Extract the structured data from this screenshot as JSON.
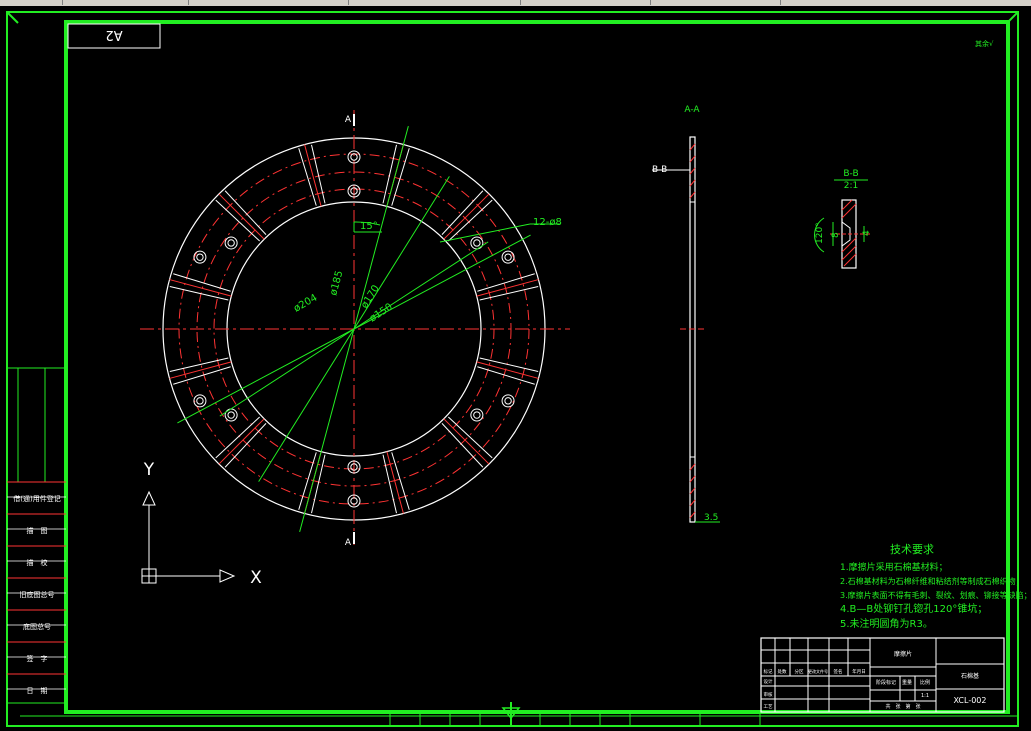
{
  "sheet": {
    "format_label": "A2",
    "corner_note": "其余√"
  },
  "views": {
    "section_aa_title": "A-A",
    "section_bb_callout": "B-B",
    "detail_bb_title": "B-B",
    "detail_bb_scale": "2:1",
    "cut_marker_top": "A",
    "cut_marker_bottom": "A"
  },
  "dimensions": {
    "angle": "15°",
    "holes": "12-ø8",
    "d204": "ø204",
    "d185": "ø185",
    "d170": "ø170",
    "d150": "ø150",
    "thickness": "3.5",
    "detail_angle": "120°",
    "detail_depth": "8",
    "detail_width": "4"
  },
  "axes": {
    "y_label": "Y",
    "x_label": "X"
  },
  "tech_req": {
    "title": "技术要求",
    "items": [
      "1.摩擦片采用石棉基材料；",
      "2.石棉基材料为石棉纤维和粘结剂等制成石棉织物；",
      "3.摩擦片表面不得有毛刺、裂纹、划痕、铆接等缺陷；",
      "4.B—B处铆钉孔锪孔120°锥坑；",
      "5.未注明圆角为R3。"
    ]
  },
  "side_table": {
    "rows": [
      "借(通)用件登记",
      "描　图",
      "描　校",
      "旧底图总号",
      "底图总号",
      "签　字",
      "日　期"
    ]
  },
  "title_block": {
    "part_name": "摩擦片",
    "material": "石棉基",
    "drawing_no": "XCL-002",
    "scale_label": "比例",
    "scale_value": "1:1",
    "row_labels": [
      "标记",
      "处数",
      "分区",
      "更改文件号",
      "签名",
      "年月日"
    ],
    "role_labels": [
      "设计",
      "审核",
      "工艺"
    ],
    "stage_label": "阶段标记",
    "weight_label": "重量",
    "sheet_label": "共　张　第　张"
  }
}
